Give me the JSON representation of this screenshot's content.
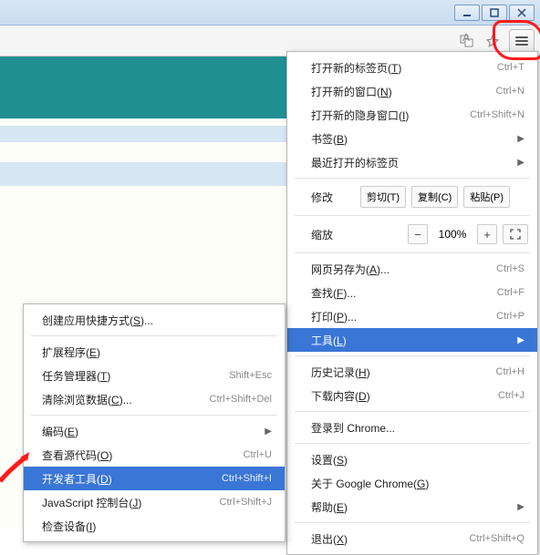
{
  "menu": {
    "new_tab": {
      "label": "打开新的标签页",
      "mn": "T",
      "short": "Ctrl+T"
    },
    "new_window": {
      "label": "打开新的窗口",
      "mn": "N",
      "short": "Ctrl+N"
    },
    "incognito": {
      "label": "打开新的隐身窗口",
      "mn": "I",
      "short": "Ctrl+Shift+N"
    },
    "bookmarks": {
      "label": "书签",
      "mn": "B"
    },
    "recent_tabs": {
      "label": "最近打开的标签页"
    },
    "edit": {
      "label": "修改",
      "cut": "剪切(T)",
      "copy": "复制(C)",
      "paste": "粘贴(P)"
    },
    "zoom": {
      "label": "缩放",
      "minus": "−",
      "value": "100%",
      "plus": "+"
    },
    "save_as": {
      "label": "网页另存为",
      "mn": "A",
      "short": "Ctrl+S"
    },
    "find": {
      "label": "查找",
      "mn": "F",
      "short": "Ctrl+F"
    },
    "print": {
      "label": "打印",
      "mn": "P",
      "short": "Ctrl+P"
    },
    "tools": {
      "label": "工具",
      "mn": "L"
    },
    "history": {
      "label": "历史记录",
      "mn": "H",
      "short": "Ctrl+H"
    },
    "downloads": {
      "label": "下载内容",
      "mn": "D",
      "short": "Ctrl+J"
    },
    "signin": {
      "label": "登录到 Chrome..."
    },
    "settings": {
      "label": "设置",
      "mn": "S"
    },
    "about": {
      "label": "关于 Google Chrome",
      "mn": "G"
    },
    "help": {
      "label": "帮助",
      "mn": "E"
    },
    "exit": {
      "label": "退出",
      "mn": "X",
      "short": "Ctrl+Shift+Q"
    }
  },
  "submenu": {
    "create_shortcuts": {
      "label": "创建应用快捷方式",
      "mn": "S"
    },
    "extensions": {
      "label": "扩展程序",
      "mn": "E"
    },
    "task_manager": {
      "label": "任务管理器",
      "mn": "T",
      "short": "Shift+Esc"
    },
    "clear_data": {
      "label": "清除浏览数据",
      "mn": "C",
      "short": "Ctrl+Shift+Del"
    },
    "encoding": {
      "label": "编码",
      "mn": "E"
    },
    "view_source": {
      "label": "查看源代码",
      "mn": "O",
      "short": "Ctrl+U"
    },
    "devtools": {
      "label": "开发者工具",
      "mn": "D",
      "short": "Ctrl+Shift+I"
    },
    "js_console": {
      "label": "JavaScript 控制台",
      "mn": "J",
      "short": "Ctrl+Shift+J"
    },
    "inspect_devices": {
      "label": "检查设备",
      "mn": "I"
    }
  }
}
